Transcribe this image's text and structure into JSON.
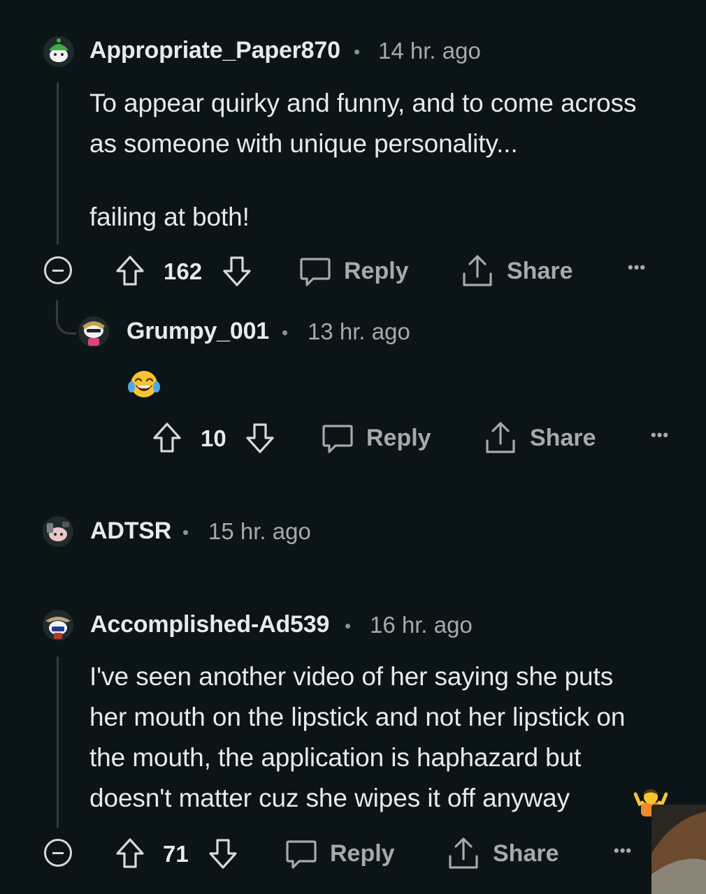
{
  "comments": [
    {
      "username": "Appropriate_Paper870",
      "time": "14 hr. ago",
      "body": [
        "To appear quirky and funny, and to come across",
        "as someone with unique personality...",
        "",
        "failing at both!"
      ],
      "votes": "162",
      "reply_label": "Reply",
      "share_label": "Share",
      "more_label": "•••"
    },
    {
      "username": "Grumpy_001",
      "time": "13 hr. ago",
      "body_emoji": "face-with-tears-of-joy",
      "votes": "10",
      "reply_label": "Reply",
      "share_label": "Share",
      "more_label": "•••"
    },
    {
      "username": "ADTSR",
      "time": "15 hr. ago"
    },
    {
      "username": "Accomplished-Ad539",
      "time": "16 hr. ago",
      "body": [
        "I've seen another video of her saying she puts",
        "her mouth on the lipstick and not her lipstick on",
        "the mouth, the application is haphazard but",
        "doesn't matter cuz she wipes it off anyway"
      ],
      "body_emoji": "person-shrugging",
      "votes": "71",
      "reply_label": "Reply",
      "share_label": "Share",
      "more_label": "•••"
    }
  ],
  "separator": "•",
  "colors": {
    "background": "#0b1416",
    "text": "#e8eaec",
    "muted": "#a3abae",
    "thread_line": "#333c3f"
  }
}
